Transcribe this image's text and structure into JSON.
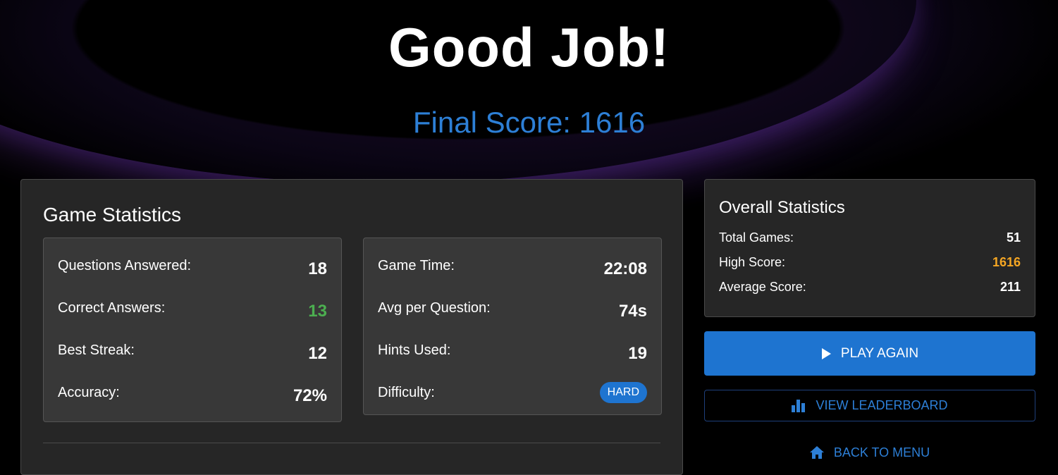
{
  "header": {
    "title": "Good Job!",
    "final_score": "Final Score: 1616"
  },
  "game_statistics": {
    "title": "Game Statistics",
    "left": [
      {
        "label": "Questions Answered:",
        "value": "18"
      },
      {
        "label": "Correct Answers:",
        "value": "13"
      },
      {
        "label": "Best Streak:",
        "value": "12"
      },
      {
        "label": "Accuracy:",
        "value": "72%"
      }
    ],
    "right": [
      {
        "label": "Game Time:",
        "value": "22:08"
      },
      {
        "label": "Avg per Question:",
        "value": "74s"
      },
      {
        "label": "Hints Used:",
        "value": "19"
      },
      {
        "label": "Difficulty:",
        "value": "HARD"
      }
    ]
  },
  "overall_statistics": {
    "title": "Overall Statistics",
    "rows": [
      {
        "label": "Total Games:",
        "value": "51"
      },
      {
        "label": "High Score:",
        "value": "1616"
      },
      {
        "label": "Average Score:",
        "value": "211"
      }
    ]
  },
  "actions": {
    "play_again": "PLAY AGAIN",
    "view_leaderboard": "VIEW LEADERBOARD",
    "back_to_menu": "BACK TO MENU"
  },
  "icons": {
    "play": "play-icon",
    "leaderboard": "bar-chart-icon",
    "menu": "home-icon"
  },
  "colors": {
    "accent": "#1e74d0",
    "score": "#2d7fd6",
    "correct": "#4caf50",
    "high_score": "#f5a623",
    "card": "#262626",
    "sub_card": "#383838"
  }
}
